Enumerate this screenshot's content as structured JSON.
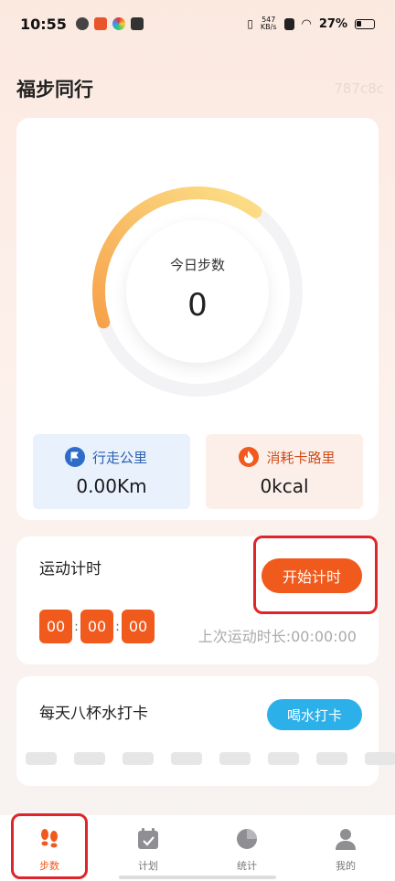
{
  "status_bar": {
    "time": "10:55",
    "net_speed_value": "547",
    "net_speed_unit": "KB/s",
    "battery": "27%"
  },
  "header": {
    "title": "福步同行",
    "code_label": "787c8c"
  },
  "steps": {
    "label": "今日步数",
    "value": "0",
    "ring_progress_visual": 0.4,
    "ring_colors": [
      "#f7a24a",
      "#fbe089"
    ],
    "distance_label": "行走公里",
    "distance_value": "0.00Km",
    "calorie_label": "消耗卡路里",
    "calorie_value": "0kcal",
    "distance_icon": "flag-icon",
    "calorie_icon": "fire-icon"
  },
  "timer": {
    "title": "运动计时",
    "start_label": "开始计时",
    "hours": "00",
    "minutes": "00",
    "seconds": "00",
    "last_duration": "上次运动时长:00:00:00"
  },
  "water": {
    "title": "每天八杯水打卡",
    "button_label": "喝水打卡",
    "cups_total": 8,
    "cups_checked": 0
  },
  "tabs": [
    {
      "label": "步数",
      "icon": "footprints-icon",
      "active": true
    },
    {
      "label": "计划",
      "icon": "calendar-check-icon",
      "active": false
    },
    {
      "label": "统计",
      "icon": "pie-chart-icon",
      "active": false
    },
    {
      "label": "我的",
      "icon": "user-icon",
      "active": false
    }
  ],
  "colors": {
    "accent": "#f05a1d",
    "water_blue": "#2cb0ea",
    "highlight_red": "#e0242b"
  }
}
